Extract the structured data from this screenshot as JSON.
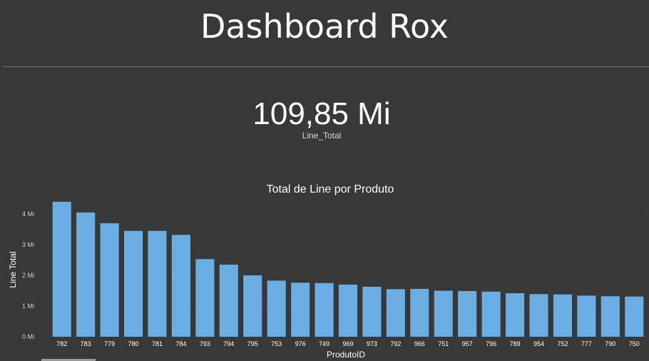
{
  "header": {
    "title": "Dashboard Rox"
  },
  "kpi": {
    "value": "109,85 Mi",
    "label": "Line_Total"
  },
  "chart_data": {
    "type": "bar",
    "title": "Total de Line por Produto",
    "xlabel": "ProdutoID",
    "ylabel": "Line Total",
    "ylim": [
      0,
      4000000
    ],
    "y_ticks": [
      0,
      1000000,
      2000000,
      3000000,
      4000000
    ],
    "y_tick_labels": [
      "0 Mi",
      "1 Mi",
      "2 Mi",
      "3 Mi",
      "4 Mi"
    ],
    "grid": true,
    "bar_color": "#6aaee4",
    "categories": [
      "782",
      "783",
      "779",
      "780",
      "781",
      "784",
      "793",
      "794",
      "795",
      "753",
      "976",
      "749",
      "969",
      "973",
      "792",
      "966",
      "751",
      "957",
      "796",
      "789",
      "954",
      "752",
      "777",
      "790",
      "750"
    ],
    "values": [
      4400000,
      4050000,
      3700000,
      3450000,
      3450000,
      3320000,
      2530000,
      2350000,
      2000000,
      1830000,
      1760000,
      1750000,
      1700000,
      1630000,
      1550000,
      1560000,
      1500000,
      1490000,
      1470000,
      1420000,
      1390000,
      1380000,
      1340000,
      1320000,
      1310000
    ]
  }
}
